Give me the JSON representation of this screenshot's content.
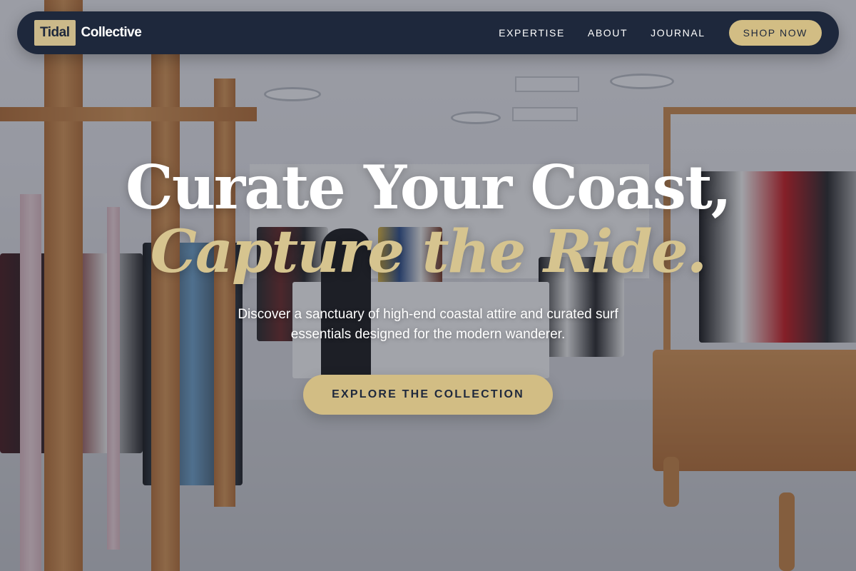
{
  "brand": {
    "mark": "Tidal",
    "name": "Collective"
  },
  "nav": {
    "links": [
      "EXPERTISE",
      "ABOUT",
      "JOURNAL"
    ],
    "cta_label": "SHOP NOW"
  },
  "hero": {
    "title_line1": "Curate Your Coast,",
    "title_line2": "Capture the Ride.",
    "subtitle": "Discover a sanctuary of high-end coastal attire and curated surf essentials designed for the modern wanderer.",
    "cta_label": "EXPLORE THE COLLECTION"
  },
  "colors": {
    "navy": "#1e283c",
    "gold": "#d2bd84",
    "accent_text": "#d6c48f"
  }
}
